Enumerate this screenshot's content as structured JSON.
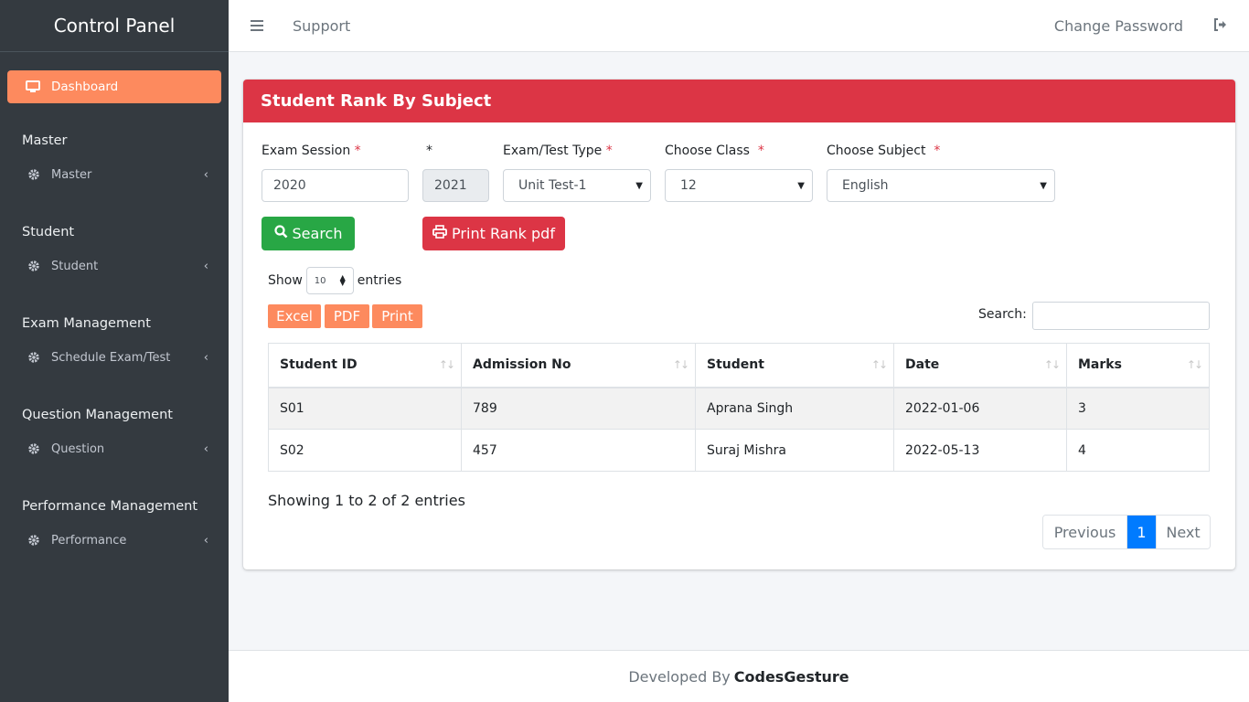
{
  "sidebar": {
    "brand": "Control Panel",
    "active_item": "Dashboard",
    "sections": [
      {
        "header": "Master",
        "item": "Master"
      },
      {
        "header": "Student",
        "item": "Student"
      },
      {
        "header": "Exam Management",
        "item": "Schedule Exam/Test"
      },
      {
        "header": "Question Management",
        "item": "Question"
      },
      {
        "header": "Performance Management",
        "item": "Performance"
      }
    ]
  },
  "topbar": {
    "support": "Support",
    "change_password": "Change Password"
  },
  "card": {
    "title": "Student Rank By Subject",
    "form": {
      "exam_session_label": "Exam Session",
      "required_mark": "*",
      "session_from": "2020",
      "session_to": "2021",
      "exam_type_label": "Exam/Test Type",
      "exam_type_value": "Unit Test-1",
      "class_label": "Choose Class",
      "class_value": "12",
      "subject_label": "Choose Subject",
      "subject_value": "English"
    },
    "buttons": {
      "search": "Search",
      "print_rank": "Print Rank pdf"
    },
    "table_controls": {
      "show": "Show",
      "entries": "entries",
      "page_length": "10",
      "excel": "Excel",
      "pdf": "PDF",
      "print": "Print",
      "search_label": "Search:"
    },
    "table": {
      "columns": [
        "Student ID",
        "Admission No",
        "Student",
        "Date",
        "Marks"
      ],
      "rows": [
        [
          "S01",
          "789",
          "Aprana Singh",
          "2022-01-06",
          "3"
        ],
        [
          "S02",
          "457",
          "Suraj Mishra",
          "2022-05-13",
          "4"
        ]
      ]
    },
    "info": "Showing 1 to 2 of 2 entries",
    "pagination": {
      "previous": "Previous",
      "current": "1",
      "next": "Next"
    }
  },
  "footer": {
    "prefix": "Developed By",
    "brand": "CodesGesture"
  },
  "colors": {
    "sidebar_bg": "#343a40",
    "active_nav": "#fd8a5e",
    "header_red": "#dc3545",
    "search_green": "#28a745",
    "page_active": "#007bff"
  }
}
